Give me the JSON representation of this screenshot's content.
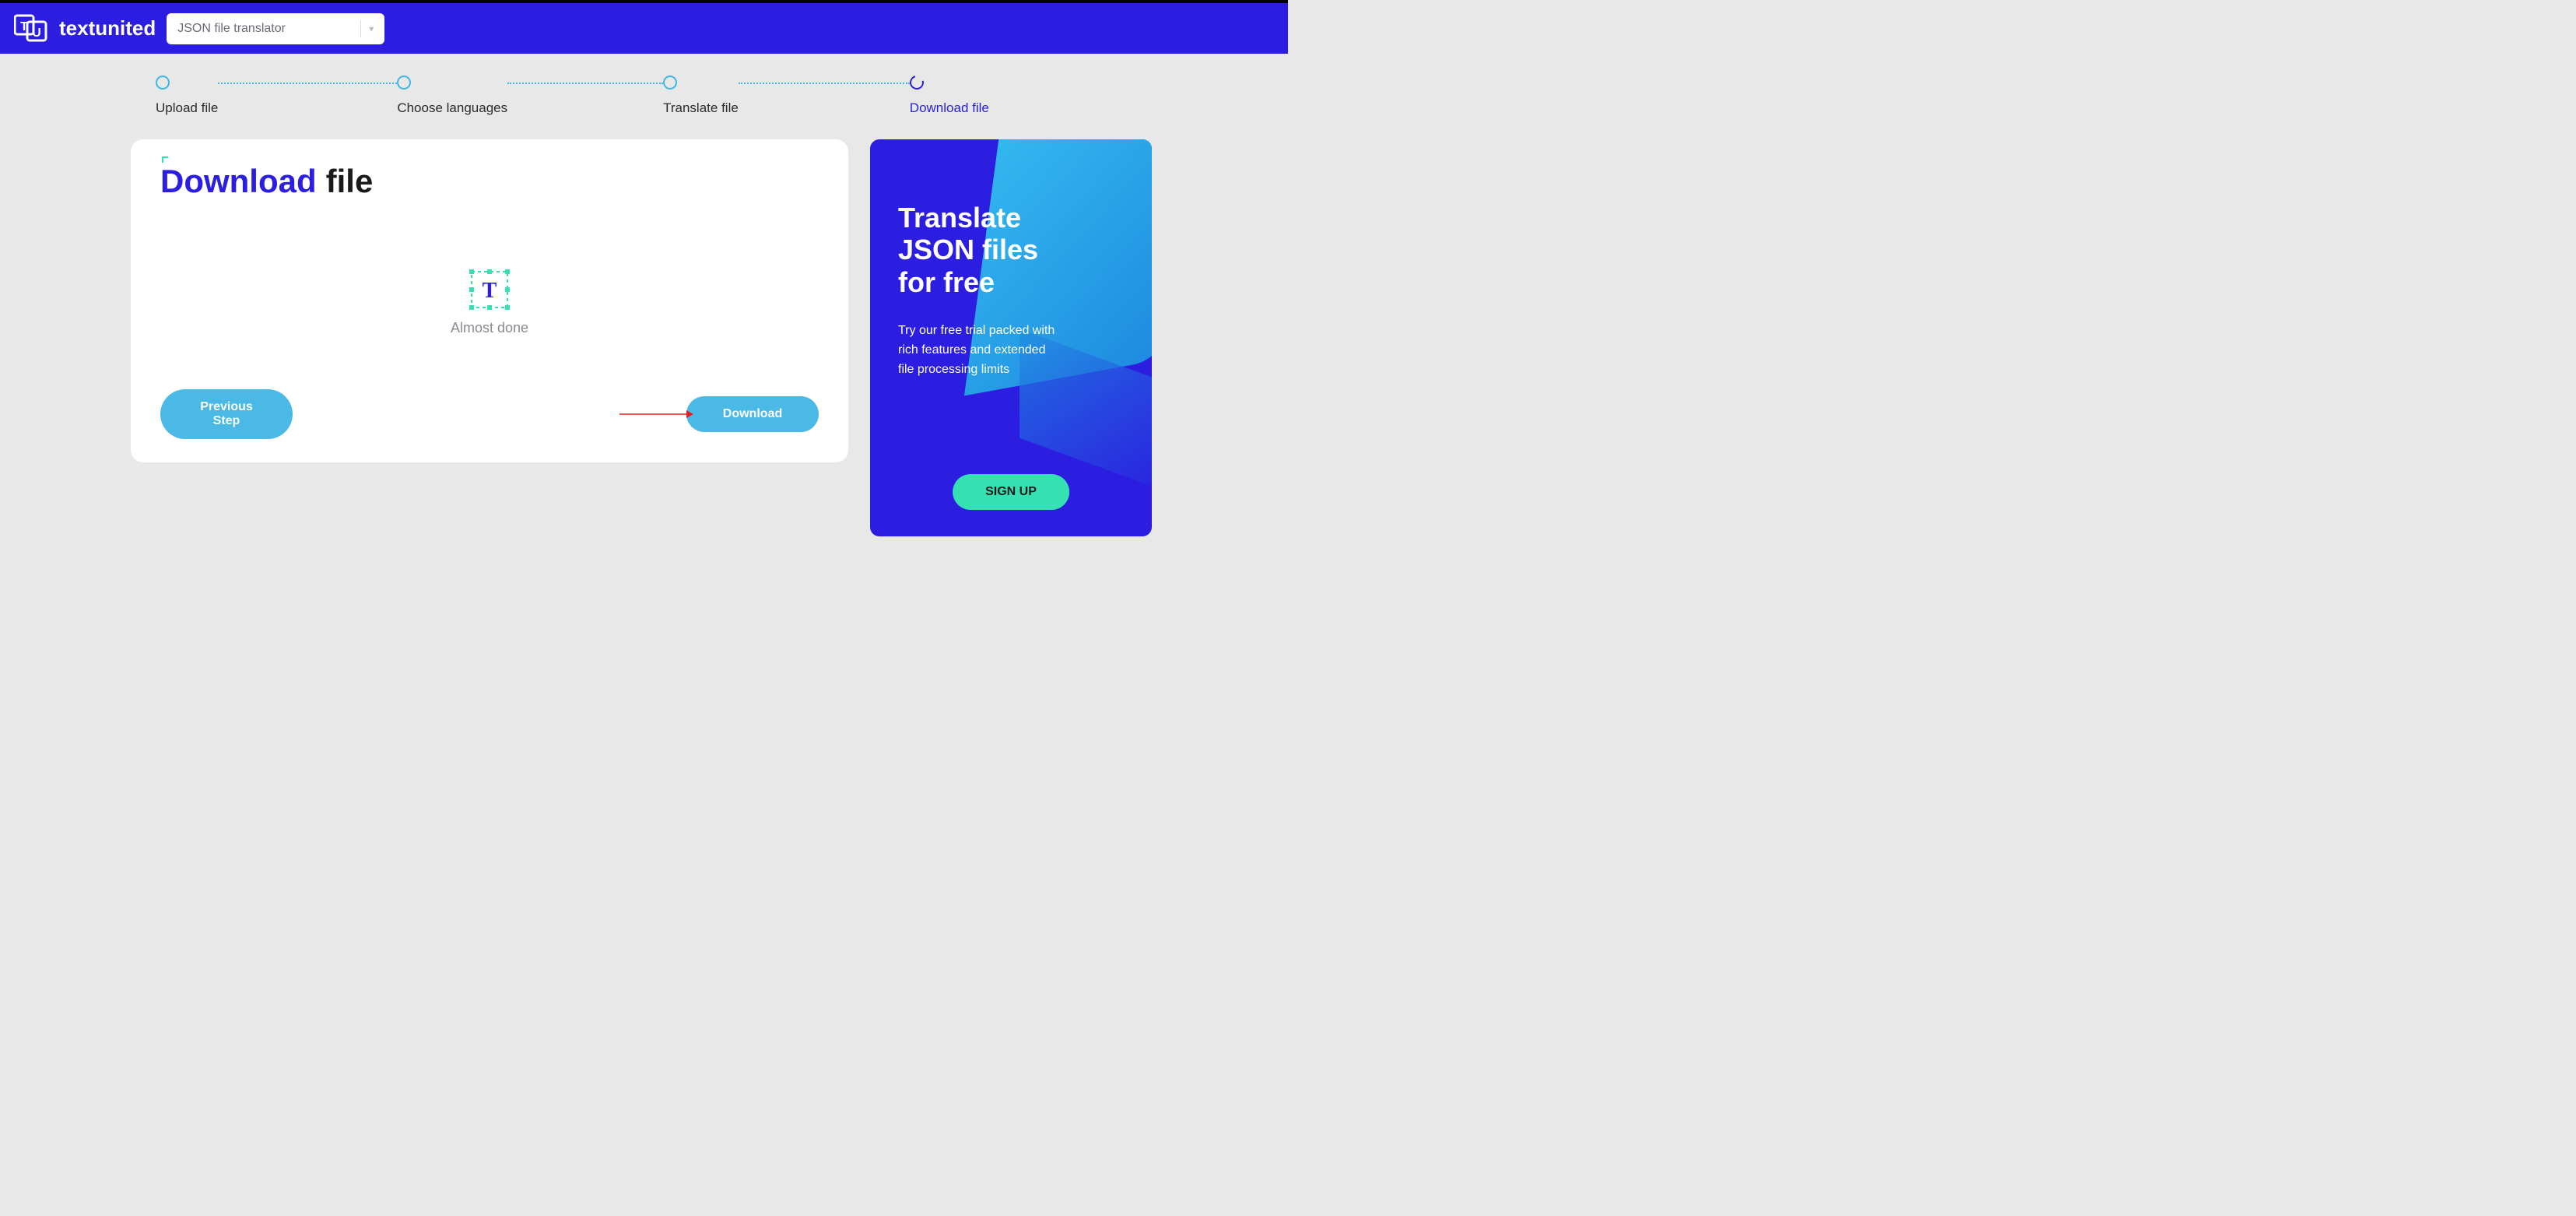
{
  "header": {
    "brand": "textunited",
    "dropdown_label": "JSON file translator"
  },
  "stepper": {
    "steps": [
      {
        "label": "Upload file"
      },
      {
        "label": "Choose languages"
      },
      {
        "label": "Translate file"
      },
      {
        "label": "Download file"
      }
    ]
  },
  "main": {
    "title_accent": "Download",
    "title_rest": "file",
    "loading_text": "Almost done",
    "prev_label": "Previous Step",
    "download_label": "Download"
  },
  "promo": {
    "title": "Translate\nJSON files\nfor free",
    "sub": "Try our free trial packed with rich features and extended file processing limits",
    "signup_label": "SIGN UP"
  }
}
